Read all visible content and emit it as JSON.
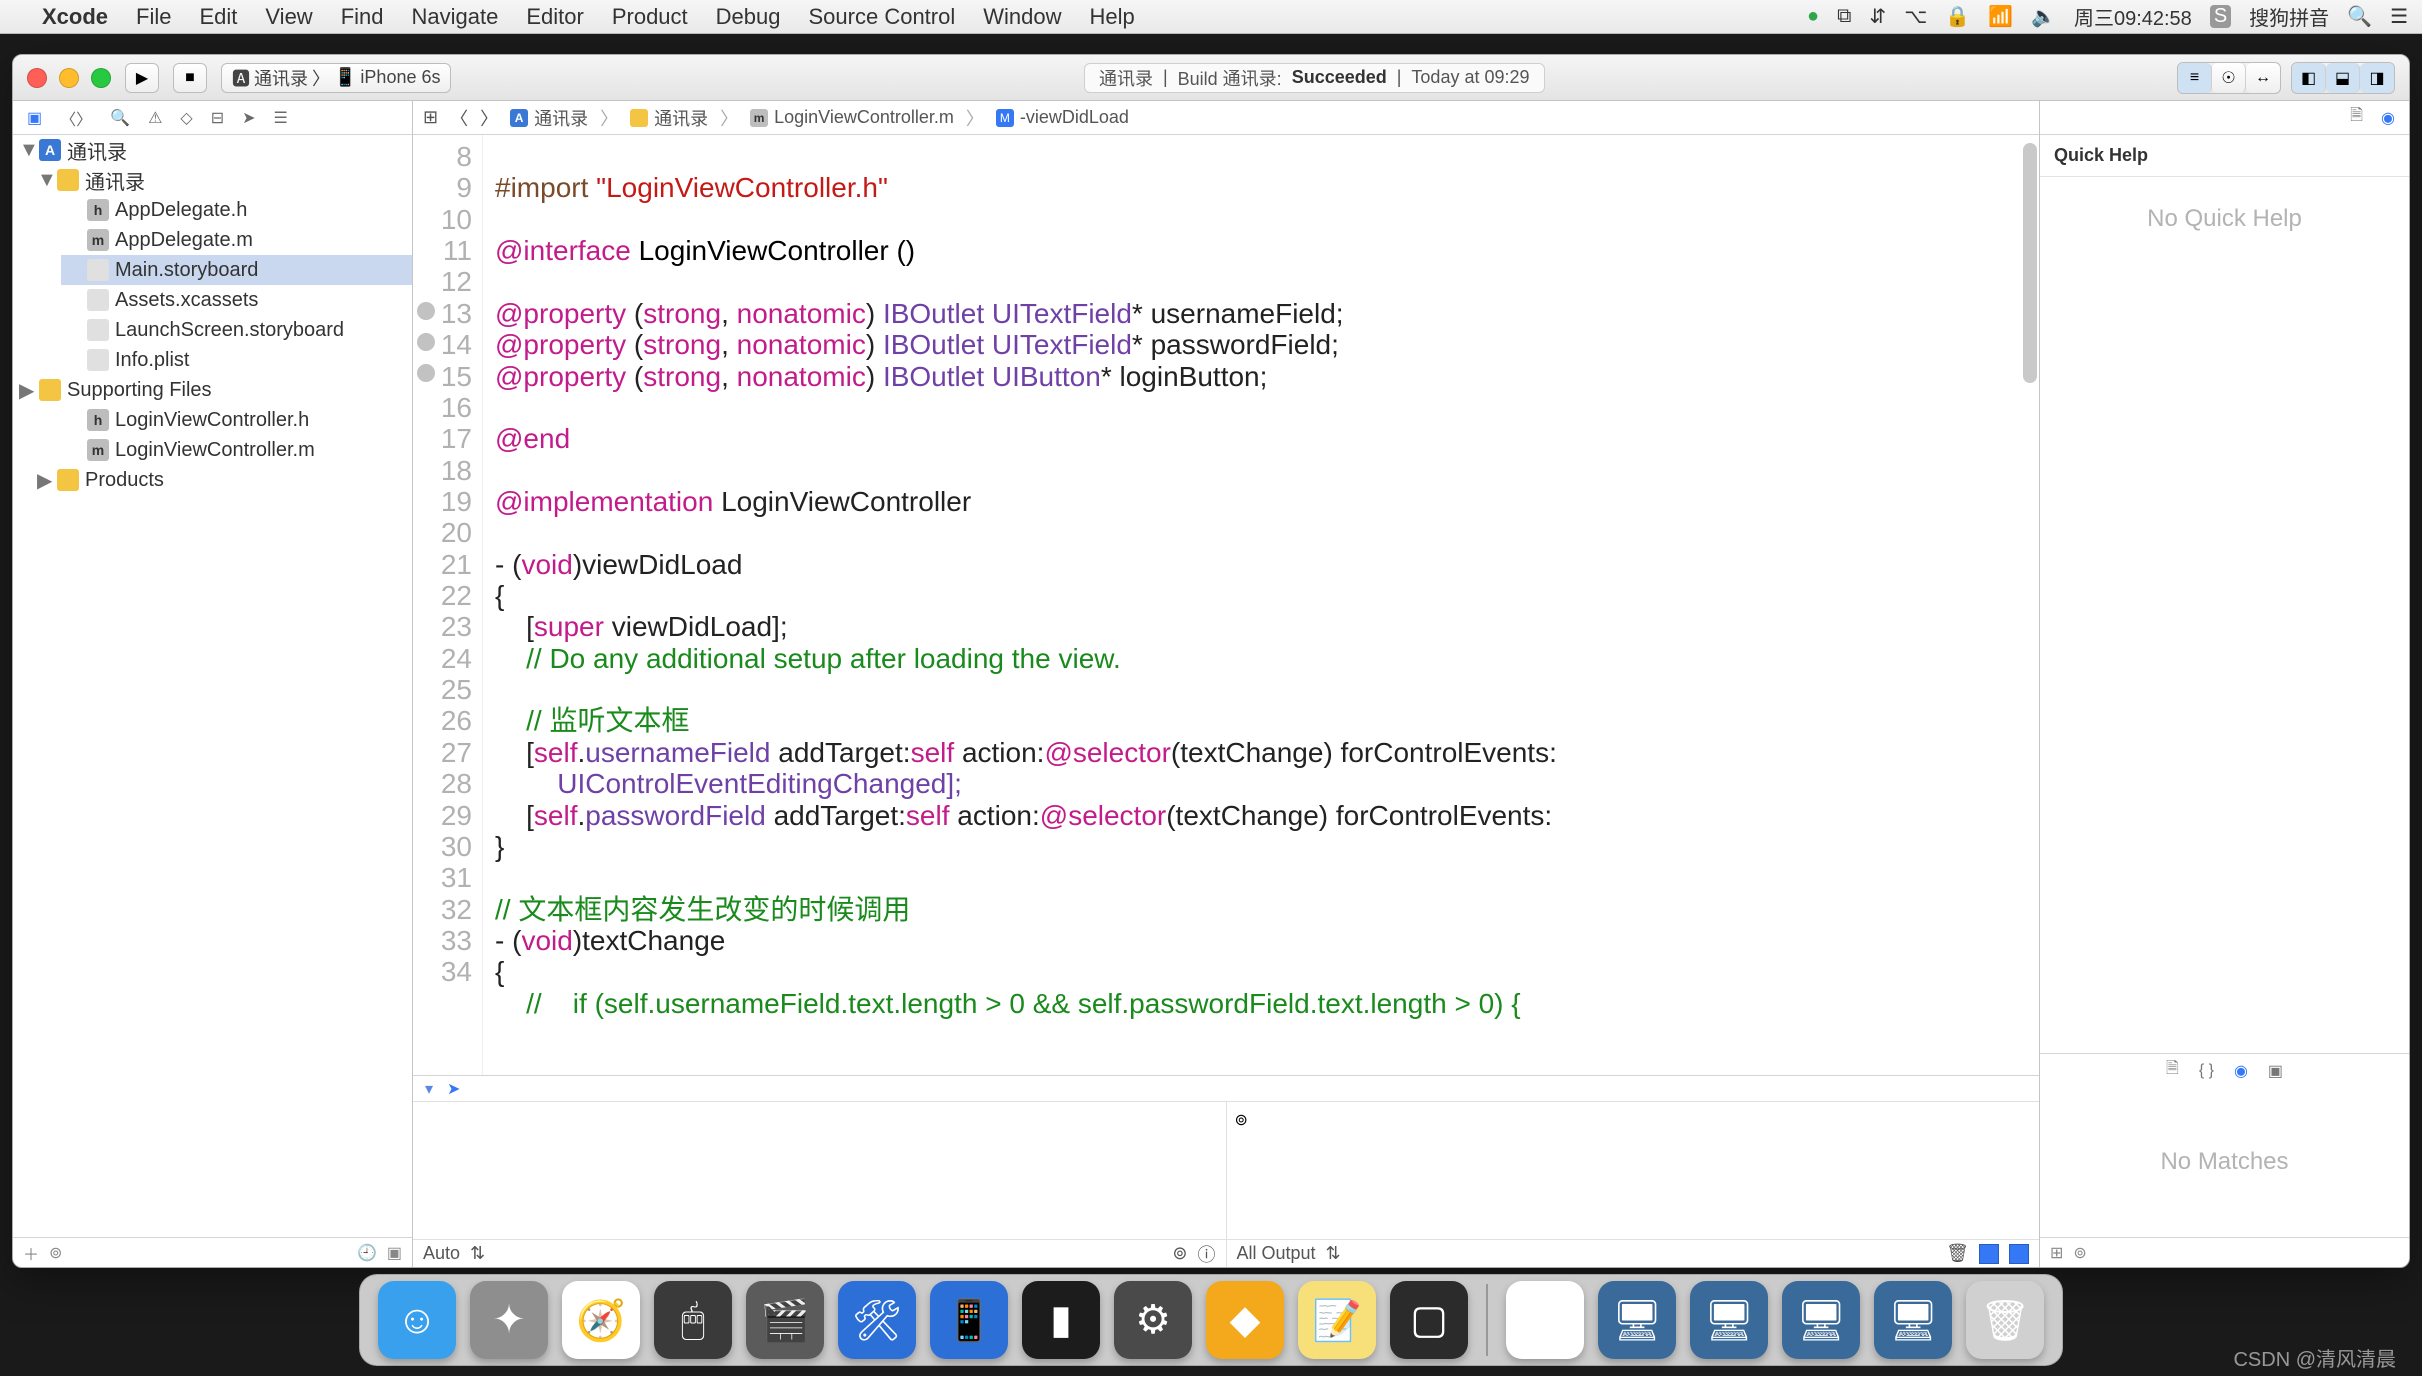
{
  "menubar": {
    "app": "Xcode",
    "items": [
      "File",
      "Edit",
      "View",
      "Find",
      "Navigate",
      "Editor",
      "Product",
      "Debug",
      "Source Control",
      "Window",
      "Help"
    ],
    "right": {
      "clock": "周三09:42:58",
      "ime_icon": "S",
      "ime": "搜狗拼音"
    }
  },
  "titlebar": {
    "scheme_app": "通讯录",
    "scheme_device": "iPhone 6s",
    "status_app": "通讯录",
    "status_build": "Build 通讯录:",
    "status_result": "Succeeded",
    "status_time": "Today at 09:29"
  },
  "nav": {
    "project": "通讯录",
    "group": "通讯录",
    "files": [
      {
        "icon": "h",
        "name": "AppDelegate.h"
      },
      {
        "icon": "m",
        "name": "AppDelegate.m"
      },
      {
        "icon": "sb",
        "name": "Main.storyboard",
        "sel": true
      },
      {
        "icon": "sb",
        "name": "Assets.xcassets"
      },
      {
        "icon": "sb",
        "name": "LaunchScreen.storyboard"
      },
      {
        "icon": "sb",
        "name": "Info.plist"
      }
    ],
    "group2": "Supporting Files",
    "files2": [
      {
        "icon": "h",
        "name": "LoginViewController.h"
      },
      {
        "icon": "m",
        "name": "LoginViewController.m"
      }
    ],
    "products": "Products"
  },
  "jump": {
    "c1": "通讯录",
    "c2": "通讯录",
    "c3": "LoginViewController.m",
    "c4": "-viewDidLoad"
  },
  "code": {
    "lines": [
      8,
      9,
      10,
      11,
      12,
      13,
      14,
      15,
      16,
      17,
      18,
      19,
      20,
      21,
      22,
      23,
      24,
      25,
      26,
      27,
      28,
      29,
      30,
      31,
      32,
      33,
      34
    ],
    "bp_lines": [
      13,
      14,
      15
    ],
    "l9a": "#import ",
    "l9b": "\"LoginViewController.h\"",
    "l11a": "@interface ",
    "l11b": "LoginViewController",
    " l11c": " ()",
    "l13a": "@property ",
    "l13b": "(",
    "l13c": "strong",
    "l13d": ", ",
    "l13e": "nonatomic",
    "l13f": ") ",
    "l13g": "IBOutlet ",
    "l13h": "UITextField",
    "l13i": "* usernameField;",
    "l14i": "* passwordField;",
    "l15h": "UIButton",
    "l15i": "* loginButton;",
    "l17": "@end",
    "l19a": "@implementation ",
    "l19b": "LoginViewController",
    "l21a": "- (",
    "l21b": "void",
    "l21c": ")viewDidLoad",
    "l22": "{",
    "l23a": "    [",
    "l23b": "super ",
    "l23c": "viewDidLoad];",
    "l24": "    // Do any additional setup after loading the view.",
    "l26": "    // 监听文本框",
    "l27a": "    [",
    "l27b": "self",
    "l27c": ".",
    "l27d": "usernameField ",
    "l27e": "addTarget:",
    "l27f": "self ",
    "l27g": "action:",
    "l27h": "@selector",
    "l27i": "(textChange) forControlEvents:",
    "l27j": "        UIControlEventEditingChanged];",
    "l28d": "passwordField ",
    "l29": "}",
    "l31": "// 文本框内容发生改变的时候调用",
    "l32a": "- (",
    "l32b": "void",
    "l32c": ")textChange",
    "l33": "{",
    "l34": "    //    if (self.usernameField.text.length > 0 && self.passwordField.text.length > 0) {"
  },
  "debug": {
    "vars": "Auto",
    "out": "All Output"
  },
  "inspector": {
    "qh_title": "Quick Help",
    "qh_empty": "No Quick Help",
    "lib_empty": "No Matches"
  },
  "dock": {
    "apps": [
      {
        "name": "finder",
        "bg": "#39a0ed",
        "g": "☺"
      },
      {
        "name": "launchpad",
        "bg": "#8e8e8e",
        "g": "✦"
      },
      {
        "name": "safari",
        "bg": "#ffffff",
        "g": "🧭"
      },
      {
        "name": "mouse",
        "bg": "#3a3a3a",
        "g": "🖱"
      },
      {
        "name": "imovie",
        "bg": "#5b5b5b",
        "g": "🎬"
      },
      {
        "name": "xcode",
        "bg": "#2c6fd6",
        "g": "🛠"
      },
      {
        "name": "iphone",
        "bg": "#2c6fd6",
        "g": "📱"
      },
      {
        "name": "terminal",
        "bg": "#1c1c1c",
        "g": "▮"
      },
      {
        "name": "settings",
        "bg": "#4a4a4a",
        "g": "⚙"
      },
      {
        "name": "sketch",
        "bg": "#f4a81b",
        "g": "◆"
      },
      {
        "name": "notes",
        "bg": "#f7e07a",
        "g": "📝"
      },
      {
        "name": "app",
        "bg": "#2b2b2b",
        "g": "▢"
      }
    ],
    "apps2": [
      {
        "name": "player",
        "bg": "#ffffff",
        "g": "▶"
      },
      {
        "name": "vm1",
        "bg": "#3a6a9a",
        "g": "🖥"
      },
      {
        "name": "vm2",
        "bg": "#3a6a9a",
        "g": "🖥"
      },
      {
        "name": "vm3",
        "bg": "#3a6a9a",
        "g": "🖥"
      },
      {
        "name": "vm4",
        "bg": "#3a6a9a",
        "g": "🖥"
      },
      {
        "name": "trash",
        "bg": "#d0d0d0",
        "g": "🗑"
      }
    ]
  },
  "watermark": "CSDN @清风清晨"
}
